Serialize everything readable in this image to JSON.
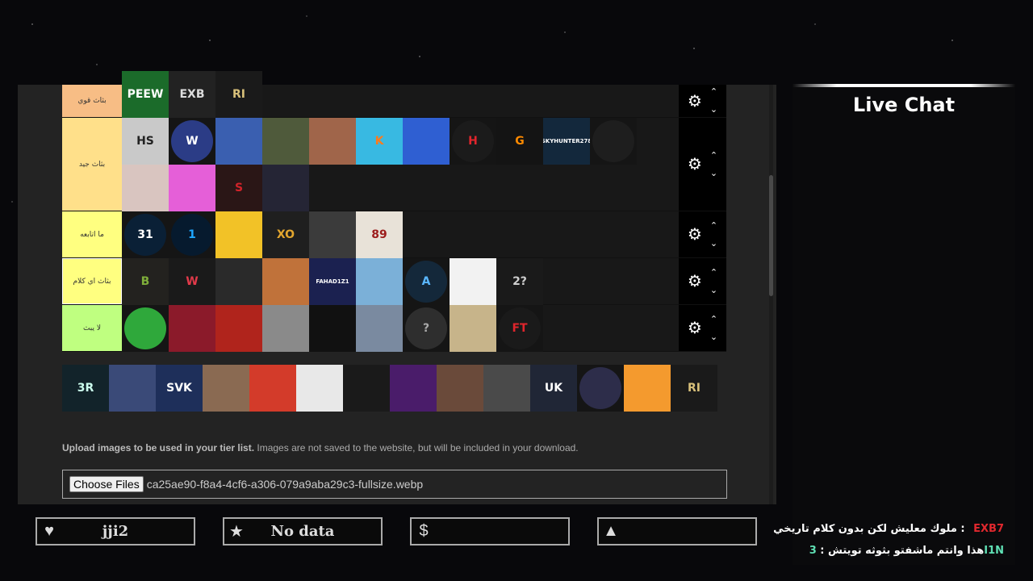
{
  "tiers": [
    {
      "label": "بثاث قوي",
      "color": "#f7bd85",
      "tiles": [
        {
          "text": "PEEW",
          "bg": "#1b6b2a",
          "fg": "#fff"
        },
        {
          "text": "EXB",
          "bg": "#222",
          "fg": "#ddd"
        },
        {
          "text": "RI",
          "bg": "#1a1a1a",
          "fg": "#d8c07a"
        }
      ]
    },
    {
      "label": "بثاث جيد",
      "color": "#ffe08a",
      "tiles": [
        {
          "text": "HS",
          "bg": "#c9c9c9",
          "fg": "#222"
        },
        {
          "text": "W",
          "bg": "#2b3c86",
          "fg": "#fff",
          "circle": true
        },
        {
          "text": "",
          "bg": "#3a5fb0",
          "fg": "#fff"
        },
        {
          "text": "",
          "bg": "#4f5a3b",
          "fg": "#fff"
        },
        {
          "text": "",
          "bg": "#a0654a",
          "fg": "#fff"
        },
        {
          "text": "K",
          "bg": "#38b9e2",
          "fg": "#ff7b1c"
        },
        {
          "text": "",
          "bg": "#2f5fd2",
          "fg": "#fff"
        },
        {
          "text": "H",
          "bg": "#1b1b1b",
          "fg": "#e0252c",
          "circle": true
        },
        {
          "text": "G",
          "bg": "#141414",
          "fg": "#ff8a00"
        },
        {
          "text": "SKYHUNTER278",
          "bg": "#13283c",
          "fg": "#fff",
          "small": true
        },
        {
          "text": "",
          "bg": "#1e1e1e",
          "fg": "#fff",
          "circle": true
        },
        {
          "text": "",
          "bg": "#d9c5c0",
          "fg": "#333"
        },
        {
          "text": "",
          "bg": "#e55fd8",
          "fg": "#fff"
        },
        {
          "text": "S",
          "bg": "#2a1616",
          "fg": "#d2232a"
        },
        {
          "text": "",
          "bg": "#252535",
          "fg": "#ddd"
        }
      ]
    },
    {
      "label": "ما اتابعه",
      "color": "#ffff80",
      "tiles": [
        {
          "text": "31",
          "bg": "#0a2036",
          "fg": "#fff",
          "circle": true
        },
        {
          "text": "1",
          "bg": "#061a2e",
          "fg": "#1ea7ff",
          "circle": true
        },
        {
          "text": "",
          "bg": "#f2c227",
          "fg": "#222"
        },
        {
          "text": "XO",
          "bg": "#1f1f1f",
          "fg": "#e3a62e"
        },
        {
          "text": "",
          "bg": "#3b3b3b",
          "fg": "#fff"
        },
        {
          "text": "89",
          "bg": "#e8e2d8",
          "fg": "#9c1b1b"
        }
      ]
    },
    {
      "label": "بثاث اي كلام",
      "color": "#ffff80",
      "tiles": [
        {
          "text": "B",
          "bg": "#23221f",
          "fg": "#7fae3a"
        },
        {
          "text": "W",
          "bg": "#1a1a1a",
          "fg": "#e23a4a"
        },
        {
          "text": "",
          "bg": "#2a2a2a",
          "fg": "#fff"
        },
        {
          "text": "",
          "bg": "#c0723a",
          "fg": "#fff"
        },
        {
          "text": "FAHAD1Z1",
          "bg": "#1b2150",
          "fg": "#fff",
          "small": true
        },
        {
          "text": "",
          "bg": "#7bb0d8",
          "fg": "#fff"
        },
        {
          "text": "A",
          "bg": "#14283a",
          "fg": "#5ab7ff",
          "circle": true
        },
        {
          "text": "",
          "bg": "#f2f2f2",
          "fg": "#111"
        },
        {
          "text": "2?",
          "bg": "#1a1a1a",
          "fg": "#cfcfcf"
        }
      ]
    },
    {
      "label": "لا يبث",
      "color": "#bfff80",
      "tiles": [
        {
          "text": "",
          "bg": "#2fa83b",
          "fg": "#fff",
          "circle": true
        },
        {
          "text": "",
          "bg": "#8b1a2a",
          "fg": "#fff"
        },
        {
          "text": "",
          "bg": "#b0241c",
          "fg": "#fff"
        },
        {
          "text": "",
          "bg": "#8a8a8a",
          "fg": "#fff"
        },
        {
          "text": "",
          "bg": "#111",
          "fg": "#fff"
        },
        {
          "text": "",
          "bg": "#7a8aa0",
          "fg": "#fff"
        },
        {
          "text": "?",
          "bg": "#2e2e2e",
          "fg": "#aaa",
          "circle": true
        },
        {
          "text": "",
          "bg": "#c7b48a",
          "fg": "#fff"
        },
        {
          "text": "FT",
          "bg": "#1a1a1a",
          "fg": "#e0252c",
          "circle": true
        }
      ]
    }
  ],
  "pool": [
    {
      "text": "3R",
      "bg": "#12232a",
      "fg": "#cfe"
    },
    {
      "text": "",
      "bg": "#3a4a78",
      "fg": "#fff"
    },
    {
      "text": "SVK",
      "bg": "#1e2f5a",
      "fg": "#fff"
    },
    {
      "text": "",
      "bg": "#8a6a52",
      "fg": "#fff"
    },
    {
      "text": "",
      "bg": "#d33b2a",
      "fg": "#fff"
    },
    {
      "text": "",
      "bg": "#e8e8e8",
      "fg": "#222"
    },
    {
      "text": "",
      "bg": "#1a1a1a",
      "fg": "#e3b23c"
    },
    {
      "text": "",
      "bg": "#4a1c6a",
      "fg": "#c58cff"
    },
    {
      "text": "",
      "bg": "#6a4a3a",
      "fg": "#fff"
    },
    {
      "text": "",
      "bg": "#4a4a4a",
      "fg": "#fff"
    },
    {
      "text": "UK",
      "bg": "#202636",
      "fg": "#fff"
    },
    {
      "text": "",
      "bg": "#2d2d4a",
      "fg": "#e58a4a",
      "circle": true
    },
    {
      "text": "",
      "bg": "#f49a2e",
      "fg": "#fff"
    },
    {
      "text": "RI",
      "bg": "#1a1a1a",
      "fg": "#d8c07a"
    }
  ],
  "upload": {
    "bold": "Upload images to be used in your tier list.",
    "rest": " Images are not saved to the website, but will be included in your download.",
    "button": "Choose Files",
    "filename": "ca25ae90-f8a4-4cf6-a306-079a9aba29c3-fullsize.webp"
  },
  "stats": [
    {
      "icon": "♥",
      "icon_name": "heart-icon",
      "value": "jji2"
    },
    {
      "icon": "★",
      "icon_name": "star-icon",
      "value": "No data"
    },
    {
      "icon": "$",
      "icon_name": "dollar-icon",
      "value": ""
    },
    {
      "icon": "▲",
      "icon_name": "triangle-icon",
      "value": ""
    }
  ],
  "chat": {
    "title": "Live Chat",
    "messages": [
      {
        "user": "EXB7",
        "user_color": "#e0282e",
        "text": "ملوك معليش لكن بدون كلام تاريخي"
      },
      {
        "user": "3I1N",
        "user_color": "#5fe0b4",
        "text": "هذا وانتم ماشفتو بثوثه تويتش"
      }
    ]
  },
  "controls": {
    "gear": "⚙",
    "up": "⌃",
    "down": "⌄"
  }
}
